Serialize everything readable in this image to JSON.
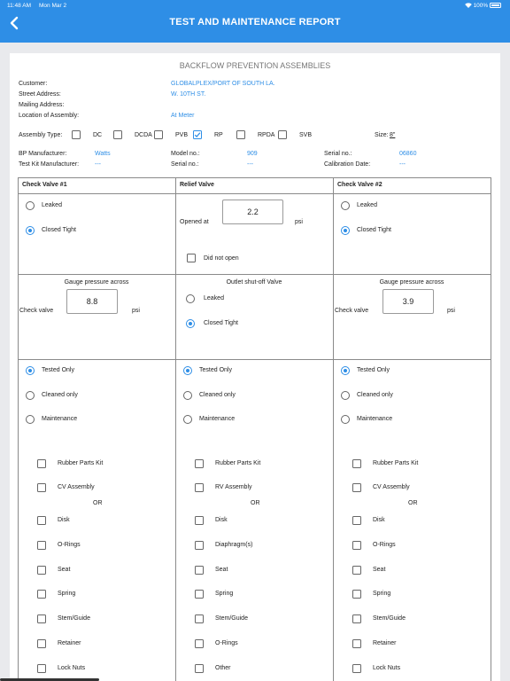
{
  "status_bar": {
    "time": "11:48 AM",
    "date": "Mon Mar 2",
    "battery": "100%"
  },
  "header": {
    "title": "TEST AND MAINTENANCE REPORT"
  },
  "section_title": "BACKFLOW PREVENTION ASSEMBLIES",
  "info": {
    "customer_label": "Customer:",
    "customer": "GLOBALPLEX/PORT OF SOUTH LA.",
    "street_label": "Street Address:",
    "street": "W. 10TH ST.",
    "mailing_label": "Mailing Address:",
    "mailing": "",
    "location_label": "Location of Assembly:",
    "location": "At Meter"
  },
  "assembly": {
    "label": "Assembly Type:",
    "types": [
      {
        "label": "DC",
        "checked": false
      },
      {
        "label": "DCDA",
        "checked": false
      },
      {
        "label": "PVB",
        "checked": false
      },
      {
        "label": "RP",
        "checked": true
      },
      {
        "label": "RPDA",
        "checked": false
      },
      {
        "label": "SVB",
        "checked": false
      }
    ],
    "size_label": "Size:",
    "size": "8\""
  },
  "meta": {
    "bp_mfr_label": "BP Manufacturer:",
    "bp_mfr": "Watts",
    "model_label": "Model no.:",
    "model": "909",
    "serial_label": "Serial no.:",
    "serial": "06860",
    "kit_mfr_label": "Test Kit Manufacturer:",
    "kit_mfr": "---",
    "kit_serial_label": "Serial no.:",
    "kit_serial": "---",
    "cal_label": "Calibration Date:",
    "cal": "---"
  },
  "col1": {
    "header": "Check Valve #1",
    "opts": [
      "Leaked",
      "Closed Tight"
    ],
    "gauge_title": "Gauge pressure across",
    "gauge_label": "Check valve",
    "gauge_value": "8.8",
    "unit": "psi"
  },
  "col2": {
    "header": "Relief Valve",
    "opened_label": "Opened at",
    "opened_value": "2.2",
    "unit": "psi",
    "not_open": "Did not open",
    "outlet_title": "Outlet shut-off Valve",
    "outlet_opts": [
      "Leaked",
      "Closed Tight"
    ]
  },
  "col3": {
    "header": "Check Valve #2",
    "opts": [
      "Leaked",
      "Closed Tight"
    ],
    "gauge_title": "Gauge pressure across",
    "gauge_label": "Check valve",
    "gauge_value": "3.9",
    "unit": "psi"
  },
  "service": [
    "Tested Only",
    "Cleaned only",
    "Maintenance"
  ],
  "parts": {
    "col1": [
      "Rubber Parts Kit",
      "CV Assembly",
      "OR",
      "Disk",
      "O-Rings",
      "Seat",
      "Spring",
      "Stem/Guide",
      "Retainer",
      "Lock Nuts"
    ],
    "col2": [
      "Rubber Parts Kit",
      "RV Assembly",
      "OR",
      "Disk",
      "Diaphragm(s)",
      "Seat",
      "Spring",
      "Stem/Guide",
      "O-Rings",
      "Other"
    ],
    "col3": [
      "Rubber Parts Kit",
      "CV Assembly",
      "OR",
      "Disk",
      "O-Rings",
      "Seat",
      "Spring",
      "Stem/Guide",
      "Retainer",
      "Lock Nuts"
    ]
  }
}
